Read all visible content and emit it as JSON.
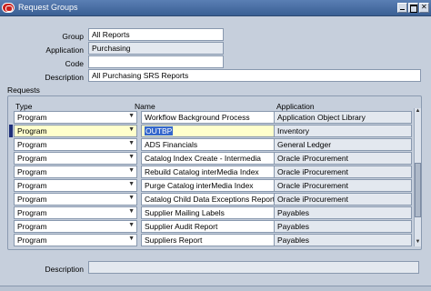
{
  "window": {
    "title": "Request Groups"
  },
  "header": {
    "group": {
      "label": "Group",
      "value": "All Reports"
    },
    "application": {
      "label": "Application",
      "value": "Purchasing"
    },
    "code": {
      "label": "Code",
      "value": ""
    },
    "description": {
      "label": "Description",
      "value": "All Purchasing SRS Reports"
    }
  },
  "requests": {
    "section_label": "Requests",
    "columns": {
      "type": "Type",
      "name": "Name",
      "application": "Application"
    },
    "rows": [
      {
        "type": "Program",
        "name": "Workflow Background Process",
        "application": "Application Object Library"
      },
      {
        "type": "Program",
        "name": "OUTBP",
        "application": "Inventory"
      },
      {
        "type": "Program",
        "name": "ADS Financials",
        "application": "General Ledger"
      },
      {
        "type": "Program",
        "name": "Catalog Index Create - Intermedia",
        "application": "Oracle iProcurement"
      },
      {
        "type": "Program",
        "name": "Rebuild Catalog interMedia Index",
        "application": "Oracle iProcurement"
      },
      {
        "type": "Program",
        "name": "Purge Catalog interMedia Index",
        "application": "Oracle iProcurement"
      },
      {
        "type": "Program",
        "name": "Catalog Child Data Exceptions Report",
        "application": "Oracle iProcurement"
      },
      {
        "type": "Program",
        "name": "Supplier Mailing Labels",
        "application": "Payables"
      },
      {
        "type": "Program",
        "name": "Supplier Audit Report",
        "application": "Payables"
      },
      {
        "type": "Program",
        "name": "Suppliers Report",
        "application": "Payables"
      }
    ],
    "description_label": "Description",
    "description_value": "",
    "lov_glyph": "···",
    "dropdown_glyph": "▼",
    "scroll_up_glyph": "▲",
    "scroll_down_glyph": "▼"
  },
  "colors": {
    "titlebar": "#3a5f94",
    "background": "#c6cfdc",
    "current_row_field": "#ffffcc",
    "selection": "#3366cc"
  },
  "icons": [
    "oracle-logo-icon",
    "minimize-icon",
    "maximize-icon",
    "close-icon",
    "dropdown-arrow-icon",
    "lov-ellipsis-icon"
  ]
}
